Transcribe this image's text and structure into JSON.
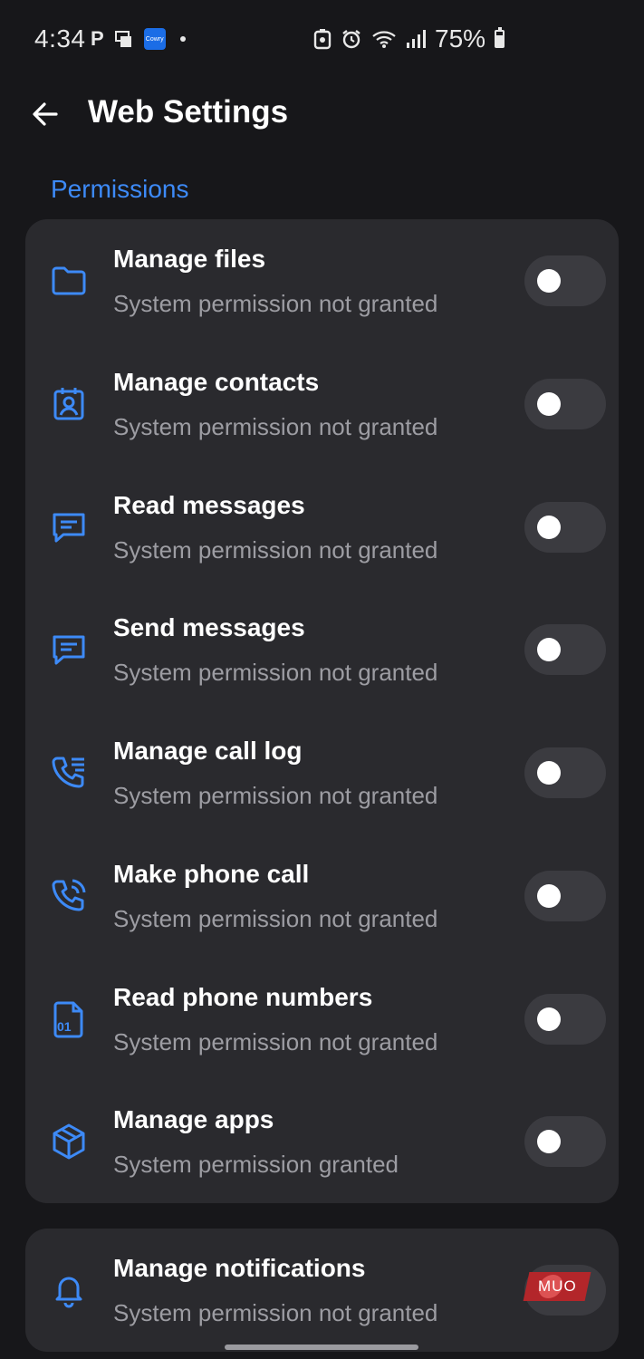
{
  "status_bar": {
    "time": "4:34",
    "app_badge": "Cowry",
    "battery": "75%",
    "battery_level": 0.75
  },
  "header": {
    "title": "Web Settings",
    "back_icon": "arrow-left-icon"
  },
  "section": {
    "title": "Permissions"
  },
  "permissions": [
    {
      "icon": "folder-icon",
      "title": "Manage files",
      "subtitle": "System permission not granted",
      "enabled": false
    },
    {
      "icon": "contact-icon",
      "title": "Manage contacts",
      "subtitle": "System permission not granted",
      "enabled": false
    },
    {
      "icon": "message-icon",
      "title": "Read messages",
      "subtitle": "System permission not granted",
      "enabled": false
    },
    {
      "icon": "message-icon",
      "title": "Send messages",
      "subtitle": "System permission not granted",
      "enabled": false
    },
    {
      "icon": "call-log-icon",
      "title": "Manage call log",
      "subtitle": "System permission not granted",
      "enabled": false
    },
    {
      "icon": "phone-call-icon",
      "title": "Make phone call",
      "subtitle": "System permission not granted",
      "enabled": false
    },
    {
      "icon": "phone-number-file-icon",
      "title": "Read phone numbers",
      "subtitle": "System permission not granted",
      "enabled": false
    },
    {
      "icon": "package-icon",
      "title": "Manage apps",
      "subtitle": "System permission granted",
      "enabled": false
    }
  ],
  "notifications": {
    "icon": "bell-icon",
    "title": "Manage notifications",
    "subtitle": "System permission not granted",
    "enabled": false,
    "watermark": "MUO"
  },
  "colors": {
    "accent": "#3d8af7",
    "background": "#17171a",
    "card": "#2a2a2e",
    "subtitle": "#9d9da3"
  }
}
